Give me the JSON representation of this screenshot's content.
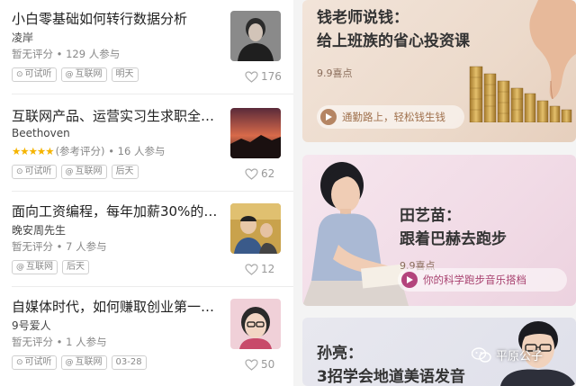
{
  "courses": [
    {
      "title": "小白零基础如何转行数据分析",
      "author": "凌岸",
      "rating_text": "暂无评分",
      "stars": "",
      "participants": "129 人参与",
      "tags": [
        {
          "icon": "play-circle-icon",
          "glyph": "⊙",
          "label": "可试听"
        },
        {
          "icon": "at-icon",
          "glyph": "@",
          "label": "互联网"
        },
        {
          "icon": "",
          "glyph": "",
          "label": "明天"
        }
      ],
      "likes": "176"
    },
    {
      "title": "互联网产品、运营实习生求职全…",
      "author": "Beethoven",
      "rating_text": "(参考评分)",
      "stars": "★★★★★",
      "participants": "16 人参与",
      "tags": [
        {
          "icon": "play-circle-icon",
          "glyph": "⊙",
          "label": "可试听"
        },
        {
          "icon": "at-icon",
          "glyph": "@",
          "label": "互联网"
        },
        {
          "icon": "",
          "glyph": "",
          "label": "后天"
        }
      ],
      "likes": "62"
    },
    {
      "title": "面向工资编程，每年加薪30%的…",
      "author": "晚安周先生",
      "rating_text": "暂无评分",
      "stars": "",
      "participants": "7 人参与",
      "tags": [
        {
          "icon": "at-icon",
          "glyph": "@",
          "label": "互联网"
        },
        {
          "icon": "",
          "glyph": "",
          "label": "后天"
        }
      ],
      "likes": "12"
    },
    {
      "title": "自媒体时代，如何赚取创业第一…",
      "author": "9号爱人",
      "rating_text": "暂无评分",
      "stars": "",
      "participants": "1 人参与",
      "tags": [
        {
          "icon": "play-circle-icon",
          "glyph": "⊙",
          "label": "可试听"
        },
        {
          "icon": "at-icon",
          "glyph": "@",
          "label": "互联网"
        },
        {
          "icon": "",
          "glyph": "",
          "label": "03-28"
        }
      ],
      "likes": "50"
    }
  ],
  "cards": [
    {
      "title_line1": "钱老师说钱：",
      "title_line2": "给上班族的省心投资课",
      "price": "9.9喜点",
      "button": "通勤路上，轻松钱生钱",
      "accent": "#b58563"
    },
    {
      "title_line1": "田艺苗：",
      "title_line2": "跟着巴赫去跑步",
      "price": "9.9喜点",
      "button": "你的科学跑步音乐搭档",
      "accent": "#b3447c"
    },
    {
      "title_line1": "孙亮：",
      "title_line2": "3招学会地道美语发音"
    }
  ],
  "watermark": "平原公子",
  "colors": {
    "star": "#f5b400",
    "text_primary": "#222222",
    "text_secondary": "#888888"
  }
}
